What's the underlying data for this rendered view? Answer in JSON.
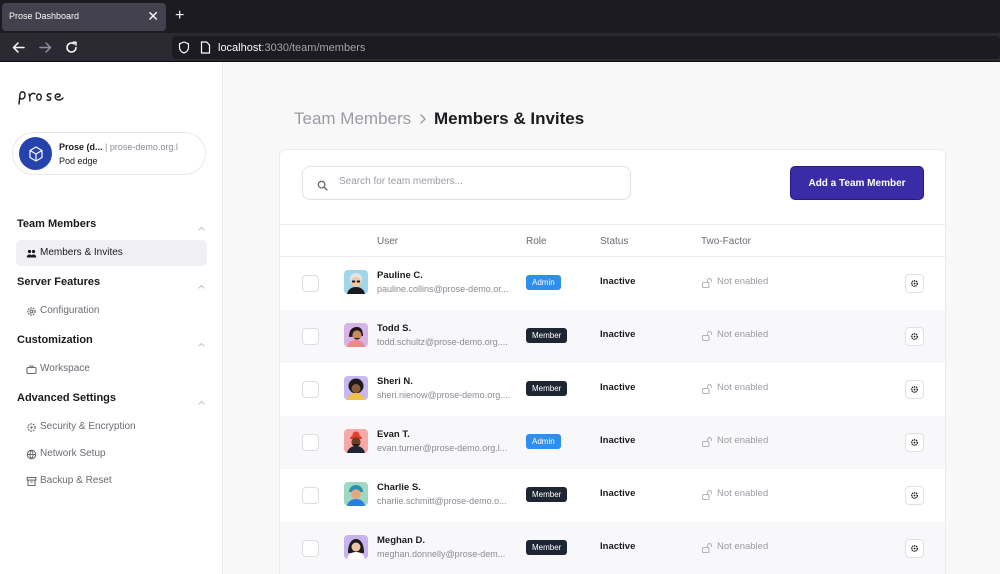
{
  "browser": {
    "tab_title": "Prose Dashboard",
    "close_glyph": "✕",
    "new_tab_glyph": "+",
    "url_host": "localhost",
    "url_rest": ":3030/team/members"
  },
  "sidebar": {
    "logo_text": "prose",
    "org": {
      "name": "Prose (d...",
      "domain": "| prose-demo.org.l",
      "node": "Pod edge"
    },
    "sections": [
      {
        "title": "Team Members",
        "items": [
          {
            "label": "Members & Invites",
            "icon": "users-icon",
            "active": true
          }
        ]
      },
      {
        "title": "Server Features",
        "items": [
          {
            "label": "Configuration",
            "icon": "gear-icon"
          }
        ]
      },
      {
        "title": "Customization",
        "items": [
          {
            "label": "Workspace",
            "icon": "briefcase-icon"
          }
        ]
      },
      {
        "title": "Advanced Settings",
        "items": [
          {
            "label": "Security & Encryption",
            "icon": "shield-icon"
          },
          {
            "label": "Network Setup",
            "icon": "globe-icon"
          },
          {
            "label": "Backup & Reset",
            "icon": "archive-icon"
          }
        ]
      }
    ]
  },
  "main": {
    "breadcrumb_root": "Team Members",
    "breadcrumb_current": "Members & Invites",
    "search_placeholder": "Search for team members...",
    "add_button": "Add a Team Member",
    "columns": {
      "user": "User",
      "role": "Role",
      "status": "Status",
      "two_factor": "Two-Factor"
    },
    "members": [
      {
        "name": "Pauline C.",
        "email": "pauline.collins@prose-demo.or...",
        "role": "Admin",
        "status": "Inactive",
        "two_factor": "Not enabled"
      },
      {
        "name": "Todd S.",
        "email": "todd.schultz@prose-demo.org....",
        "role": "Member",
        "status": "Inactive",
        "two_factor": "Not enabled"
      },
      {
        "name": "Sheri N.",
        "email": "sheri.nienow@prose-demo.org....",
        "role": "Member",
        "status": "Inactive",
        "two_factor": "Not enabled"
      },
      {
        "name": "Evan T.",
        "email": "evan.turner@prose-demo.org.l...",
        "role": "Admin",
        "status": "Inactive",
        "two_factor": "Not enabled"
      },
      {
        "name": "Charlie S.",
        "email": "charlie.schmitt@prose-demo.o...",
        "role": "Member",
        "status": "Inactive",
        "two_factor": "Not enabled"
      },
      {
        "name": "Meghan D.",
        "email": "meghan.donnelly@prose-dem...",
        "role": "Member",
        "status": "Inactive",
        "two_factor": "Not enabled"
      }
    ]
  },
  "colors": {
    "accent": "#3a2ca6",
    "admin_badge": "#2f8ff0",
    "member_badge": "#1f2633",
    "org_avatar": "#2643ad"
  }
}
